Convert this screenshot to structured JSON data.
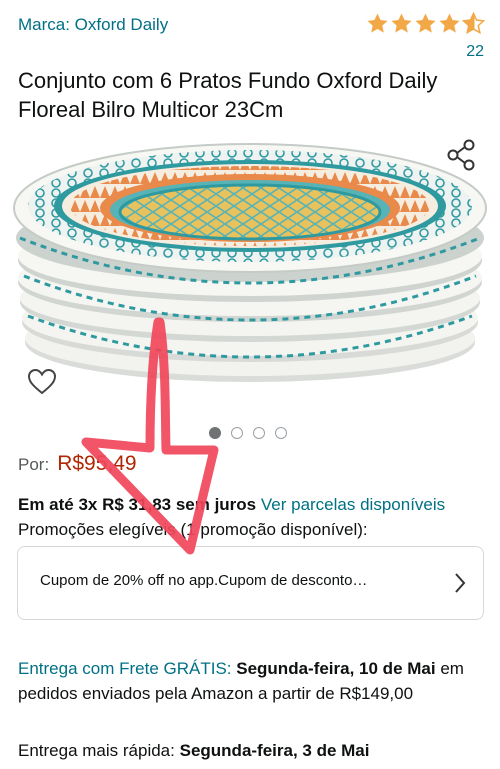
{
  "brand": {
    "label": "Marca: Oxford Daily"
  },
  "rating": {
    "stars": 4.5,
    "count": "22",
    "color": "#f3a847"
  },
  "product": {
    "title": "Conjunto com 6 Pratos Fundo Oxford Daily Floreal Bilro Multicor 23Cm"
  },
  "carousel": {
    "image_count": 4,
    "active_index": 0
  },
  "price": {
    "label": "Por:",
    "value": "R$95,49"
  },
  "installments": {
    "text": "Em até 3x R$ 31,83 sem juros",
    "link": "Ver parcelas disponíveis"
  },
  "promotions": {
    "text": "Promoções elegíveis (1 promoção disponível):"
  },
  "coupon": {
    "text": "Cupom de 20% off no app.Cupom de desconto…"
  },
  "delivery": {
    "prefix": "Entrega com Frete GRÁTIS:",
    "date": "Segunda-feira, 10 de Mai",
    "suffix": "em pedidos enviados pela Amazon a partir de R$149,00"
  },
  "fast_delivery": {
    "prefix": "Entrega mais rápida:",
    "date": "Segunda-feira, 3 de Mai"
  },
  "colors": {
    "link": "#007185",
    "price": "#b12704",
    "annotation": "#f0475a"
  }
}
